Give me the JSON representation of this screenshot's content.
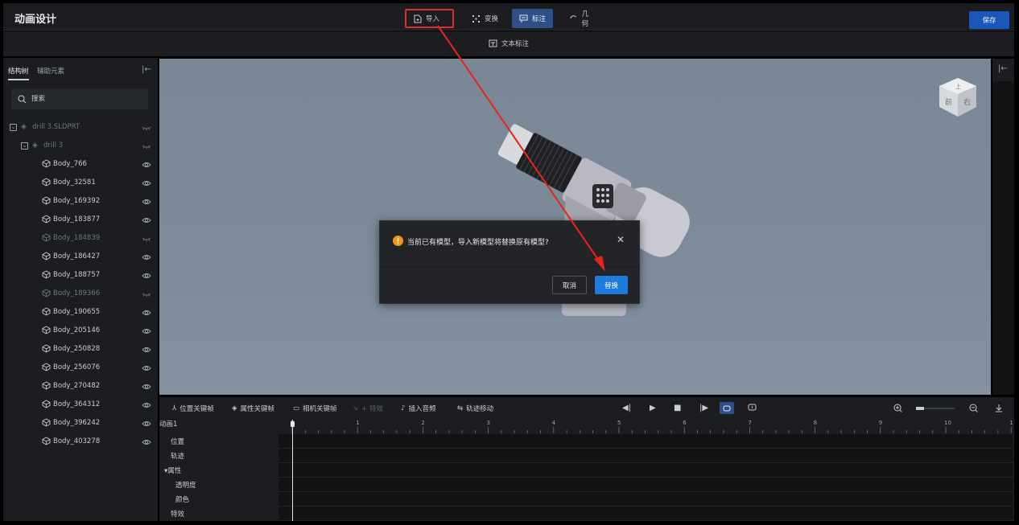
{
  "header": {
    "title": "动画设计",
    "toolbar": [
      {
        "id": "import",
        "label": "导入",
        "icon": "file-import-icon"
      },
      {
        "id": "transform",
        "label": "变换",
        "icon": "transform-icon"
      },
      {
        "id": "annotate",
        "label": "标注",
        "icon": "annotation-icon",
        "active": true
      },
      {
        "id": "geometry",
        "label": "几何",
        "icon": "geometry-icon"
      }
    ],
    "save_label": "保存"
  },
  "subtoolbar": {
    "text_annotation_label": "文本标注"
  },
  "left_panel": {
    "tabs": [
      "结构树",
      "辅助元素"
    ],
    "search_placeholder": "搜索",
    "tree": [
      {
        "label": "drill 3.SLDPRT",
        "level": 0,
        "dim": true,
        "hidden": true
      },
      {
        "label": "drill 3",
        "level": 1,
        "dim": true,
        "hidden": true
      },
      {
        "label": "Body_766",
        "level": 2
      },
      {
        "label": "Body_32581",
        "level": 2
      },
      {
        "label": "Body_169392",
        "level": 2
      },
      {
        "label": "Body_183877",
        "level": 2
      },
      {
        "label": "Body_184839",
        "level": 2,
        "dim": true,
        "hidden": true
      },
      {
        "label": "Body_186427",
        "level": 2
      },
      {
        "label": "Body_188757",
        "level": 2
      },
      {
        "label": "Body_189366",
        "level": 2,
        "dim": true,
        "hidden": true
      },
      {
        "label": "Body_190655",
        "level": 2
      },
      {
        "label": "Body_205146",
        "level": 2
      },
      {
        "label": "Body_250828",
        "level": 2
      },
      {
        "label": "Body_256076",
        "level": 2
      },
      {
        "label": "Body_270482",
        "level": 2
      },
      {
        "label": "Body_364312",
        "level": 2
      },
      {
        "label": "Body_396242",
        "level": 2
      },
      {
        "label": "Body_403278",
        "level": 2
      }
    ]
  },
  "viewcube": {
    "front_label": "前",
    "right_label": "右",
    "top_label": "上"
  },
  "dialog": {
    "message": "当前已有模型，导入新模型将替换原有模型?",
    "cancel_label": "取消",
    "confirm_label": "替换"
  },
  "timeline": {
    "toolbar": [
      {
        "label": "位置关键帧",
        "icon": "position-keyframe-icon"
      },
      {
        "label": "属性关键帧",
        "icon": "property-keyframe-icon"
      },
      {
        "label": "相机关键帧",
        "icon": "camera-keyframe-icon"
      },
      {
        "label": "+ 特效",
        "icon": "effect-icon",
        "disabled": true
      },
      {
        "label": "插入音频",
        "icon": "audio-icon"
      },
      {
        "label": "轨迹移动",
        "icon": "trajectory-icon"
      }
    ],
    "animation_name": "动画1",
    "tracks": [
      "位置",
      "轨迹",
      "▾属性",
      "透明度",
      "颜色",
      "特效"
    ],
    "ruler_ticks": [
      "0",
      "1",
      "2",
      "3",
      "4",
      "5",
      "6",
      "7",
      "8",
      "9",
      "10",
      "1"
    ],
    "playhead_time": 0
  },
  "colors": {
    "accent": "#1f7ae0",
    "active_tab": "#2f4f86",
    "highlight_red": "#e02f23",
    "panel_bg": "#1b1d21"
  }
}
